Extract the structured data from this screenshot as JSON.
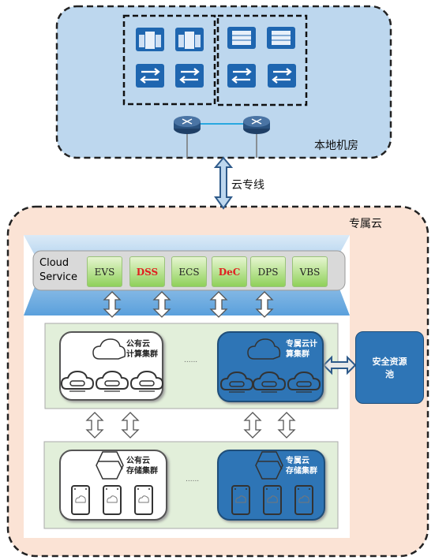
{
  "local_room": {
    "label": "本地机房"
  },
  "link": {
    "label": "云专线"
  },
  "dedicated_cloud": {
    "label": "专属云"
  },
  "cloud_service": {
    "label_line1": "Cloud",
    "label_line2": "Service",
    "services": [
      {
        "name": "EVS",
        "color": "#222222"
      },
      {
        "name": "DSS",
        "color": "#e02020"
      },
      {
        "name": "ECS",
        "color": "#222222"
      },
      {
        "name": "DeC",
        "color": "#e02020"
      },
      {
        "name": "DPS",
        "color": "#222222"
      },
      {
        "name": "VBS",
        "color": "#222222"
      }
    ]
  },
  "compute": {
    "public_line1": "公有云",
    "public_line2": "计算集群",
    "dedicated_line1": "专属云计",
    "dedicated_line2": "算集群",
    "ellipsis": "......"
  },
  "storage": {
    "public_line1": "公有云",
    "public_line2": "存储集群",
    "dedicated_line1": "专属云",
    "dedicated_line2": "存储集群",
    "ellipsis": "......"
  },
  "security": {
    "label_line1": "安全资源",
    "label_line2": "池"
  },
  "colors": {
    "local_bg": "#bdd7ee",
    "cloud_bg": "#fbe3d5",
    "accent_blue": "#2e75b6",
    "panel_green": "#e2efda"
  }
}
